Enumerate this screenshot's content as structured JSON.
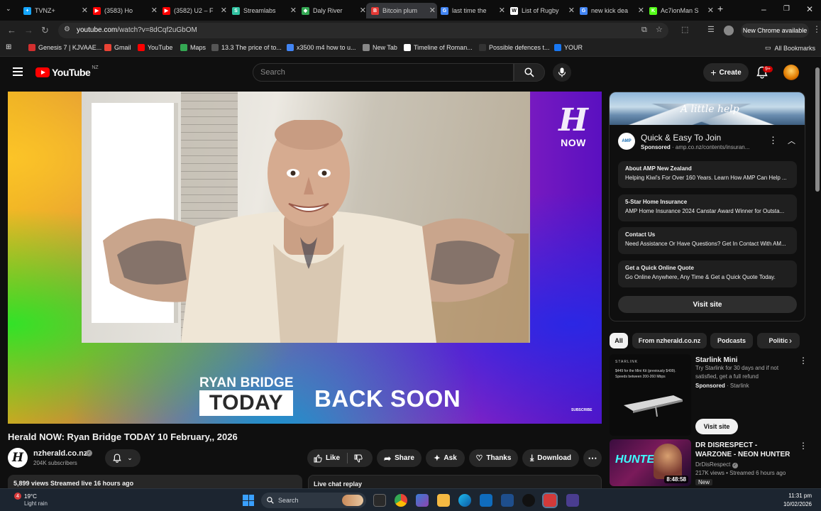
{
  "browser": {
    "tabs": [
      {
        "title": "TVNZ+",
        "color": "#15a6ff",
        "glyph": "+"
      },
      {
        "title": "(3583) Ho",
        "color": "#ff0000",
        "glyph": "▶"
      },
      {
        "title": "(3582) U2 – F",
        "color": "#ff0000",
        "glyph": "▶"
      },
      {
        "title": "Streamlabs",
        "color": "#31c3a2",
        "glyph": "S"
      },
      {
        "title": "Daly River",
        "color": "#34a853",
        "glyph": "◆"
      },
      {
        "title": "Bitcoin plum",
        "color": "#e53935",
        "glyph": "B"
      },
      {
        "title": "last time the",
        "color": "#4285f4",
        "glyph": "G"
      },
      {
        "title": "List of Rugby",
        "color": "#ffffff",
        "glyph": "W"
      },
      {
        "title": "new kick dea",
        "color": "#4285f4",
        "glyph": "G"
      },
      {
        "title": "Ac7ionMan S",
        "color": "#53fc18",
        "glyph": "K"
      }
    ],
    "new_tab": "+",
    "url_domain": "youtube.com",
    "url_path": "/watch?v=8dCqf2uGbOM",
    "new_chrome": "New Chrome available",
    "bookmarks": [
      {
        "label": "Genesis 7 | KJVAAE...",
        "color": "#d32f2f"
      },
      {
        "label": "Gmail",
        "color": "#ea4335"
      },
      {
        "label": "YouTube",
        "color": "#ff0000"
      },
      {
        "label": "Maps",
        "color": "#34a853"
      },
      {
        "label": "13.3 The price of to...",
        "color": "#555555"
      },
      {
        "label": "x3500 m4 how to u...",
        "color": "#4285f4"
      },
      {
        "label": "New Tab",
        "color": "#888888"
      },
      {
        "label": "Timeline of Roman...",
        "color": "#ffffff"
      },
      {
        "label": "Possible defences t...",
        "color": "#333333"
      },
      {
        "label": "YOUR",
        "color": "#1877f2"
      }
    ],
    "all_bookmarks": "All Bookmarks"
  },
  "youtube": {
    "country": "NZ",
    "logo_text": "YouTube",
    "search_placeholder": "Search",
    "create_label": "Create",
    "notif_count": "9+"
  },
  "video": {
    "overlay_brand": "NOW",
    "show_line1": "RYAN BRIDGE",
    "show_line2": "TODAY",
    "status": "BACK SOON",
    "subscribe": "SUBSCRIBE",
    "title": "Herald NOW: Ryan Bridge TODAY 10 February,, 2026",
    "channel": "nzherald.co.nz",
    "subscribers": "204K subscribers",
    "like": "Like",
    "share": "Share",
    "ask": "Ask",
    "thanks": "Thanks",
    "download": "Download",
    "meta": "5,899 views  Streamed live 16 hours ago",
    "live_chat": "Live chat replay"
  },
  "ad": {
    "banner_tagline": "A little help",
    "title": "Quick & Easy To Join",
    "sponsored": "Sponsored",
    "domain": "amp.co.nz/contents/insuran...",
    "sitelinks": [
      {
        "title": "About AMP New Zealand",
        "desc": "Helping Kiwi's For Over 160 Years. Learn How AMP Can Help ..."
      },
      {
        "title": "5-Star Home Insurance",
        "desc": "AMP Home Insurance 2024 Canstar Award Winner for Outsta..."
      },
      {
        "title": "Contact Us",
        "desc": "Need Assistance Or Have Questions? Get In Contact With AM..."
      },
      {
        "title": "Get a Quick Online Quote",
        "desc": "Go Online Anywhere, Any Time & Get a Quick Quote Today."
      }
    ],
    "visit_site": "Visit site"
  },
  "chips": [
    "All",
    "From nzherald.co.nz",
    "Podcasts",
    "Politic"
  ],
  "recommendations": [
    {
      "title": "Starlink Mini",
      "line1": "Try Starlink for 30 days and if not",
      "line2": "satisfied, get a full refund",
      "sponsored": "Sponsored",
      "advertiser": "Starlink",
      "cta": "Visit site",
      "thumb_brand": "STARLINK",
      "thumb_text": "$449 for the Mini Kit (previously $499). Speeds between 200-260 Mbps"
    },
    {
      "title": "DR DISRESPECT - WARZONE - NEON HUNTER",
      "channel": "DrDisRespect",
      "stats": "217K views • Streamed 6 hours ago",
      "badge": "New",
      "duration": "8:48:58",
      "thumb_text": "HUNTER"
    }
  ],
  "taskbar": {
    "weather_badge": "4",
    "temperature": "19°C",
    "condition": "Light rain",
    "search": "Search",
    "time": "11:31 pm",
    "date": "10/02/2026"
  }
}
